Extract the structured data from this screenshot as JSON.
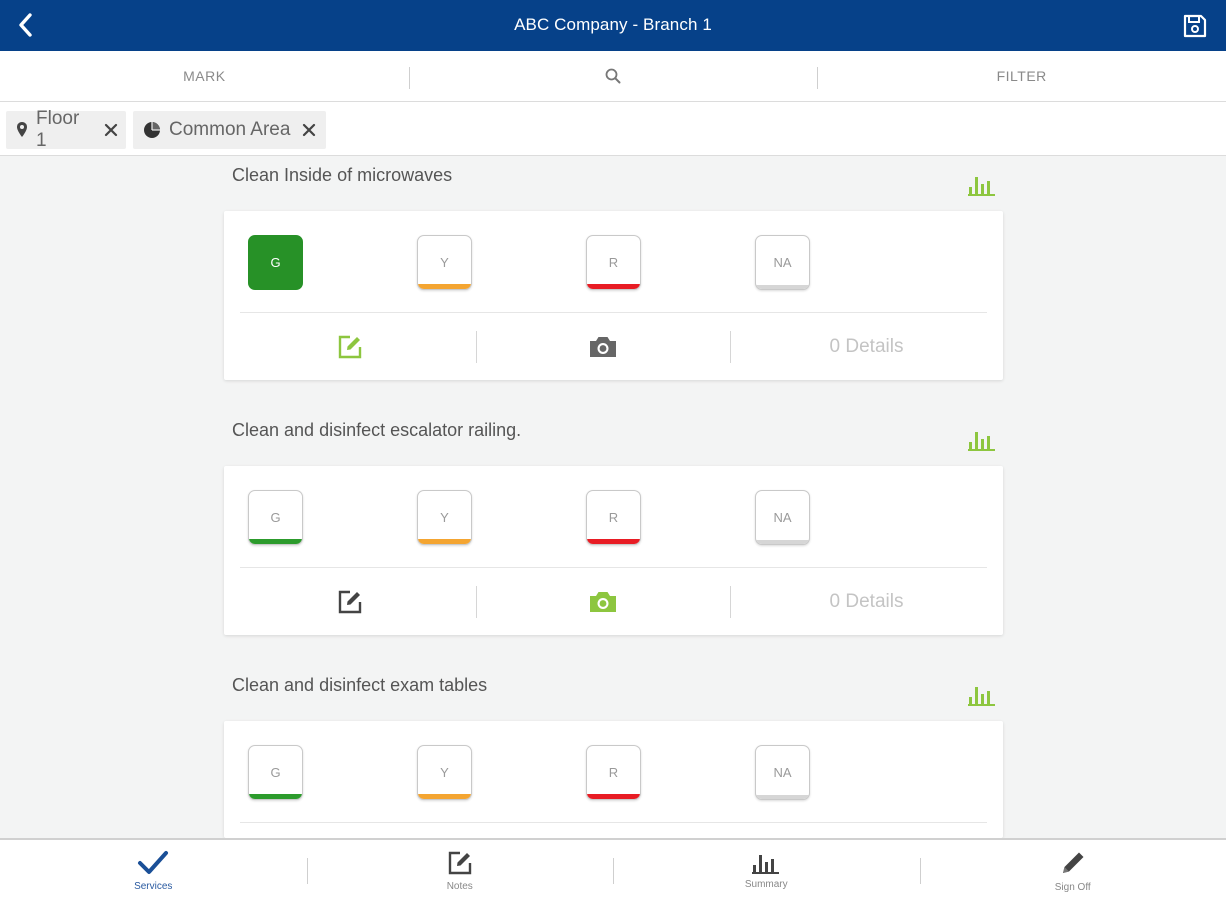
{
  "header": {
    "title": "ABC Company - Branch 1"
  },
  "toolbar": {
    "mark_label": "MARK",
    "filter_label": "FILTER"
  },
  "chips": [
    {
      "label": "Floor 1"
    },
    {
      "label": "Common Area"
    }
  ],
  "tasks": [
    {
      "title": "Clean Inside of microwaves",
      "marks": [
        "G",
        "Y",
        "R",
        "NA"
      ],
      "selected": "G",
      "details": "0 Details"
    },
    {
      "title": "Clean and disinfect escalator railing.",
      "marks": [
        "G",
        "Y",
        "R",
        "NA"
      ],
      "selected": "",
      "details": "0 Details"
    },
    {
      "title": "Clean and disinfect exam tables",
      "marks": [
        "G",
        "Y",
        "R",
        "NA"
      ],
      "selected": "",
      "details": ""
    }
  ],
  "bottom_nav": [
    {
      "label": "Services",
      "active": true
    },
    {
      "label": "Notes"
    },
    {
      "label": "Summary"
    },
    {
      "label": "Sign Off"
    }
  ],
  "colors": {
    "header": "#064189",
    "green": "#279127",
    "yellow": "#f4a531",
    "red": "#e81c24",
    "accent_lime": "#8dc63f"
  }
}
